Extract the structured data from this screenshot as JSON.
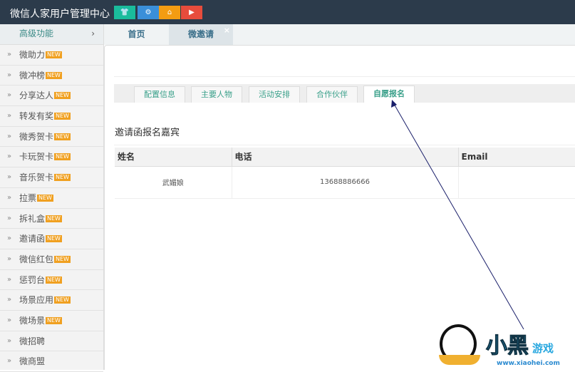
{
  "header": {
    "title": "微信人家用户管理中心",
    "buttons": [
      {
        "icon": "shirt-icon",
        "color": "#1abc9c"
      },
      {
        "icon": "gear-icon",
        "color": "#3a8fd9"
      },
      {
        "icon": "home-icon",
        "color": "#f39c12"
      },
      {
        "icon": "play-icon",
        "color": "#e74c3c"
      }
    ]
  },
  "sidebar": {
    "header": "高级功能",
    "badge": "NEW",
    "items": [
      {
        "label": "微助力",
        "new": true
      },
      {
        "label": "微冲榜",
        "new": true
      },
      {
        "label": "分享达人",
        "new": true
      },
      {
        "label": "转发有奖",
        "new": true
      },
      {
        "label": "微秀贺卡",
        "new": true
      },
      {
        "label": "卡玩贺卡",
        "new": true
      },
      {
        "label": "音乐贺卡",
        "new": true
      },
      {
        "label": "拉票",
        "new": true
      },
      {
        "label": "拆礼盒",
        "new": true
      },
      {
        "label": "邀请函",
        "new": true
      },
      {
        "label": "微信红包",
        "new": true
      },
      {
        "label": "惩罚台",
        "new": true
      },
      {
        "label": "场景应用",
        "new": true
      },
      {
        "label": "微场景",
        "new": true
      },
      {
        "label": "微招聘",
        "new": false
      },
      {
        "label": "微商盟",
        "new": false
      }
    ]
  },
  "tabs": [
    {
      "label": "首页"
    },
    {
      "label": "微邀请",
      "closable": true
    }
  ],
  "subtabs": [
    "配置信息",
    "主要人物",
    "活动安排",
    "合作伙伴",
    "自愿报名"
  ],
  "active_subtab": "自愿报名",
  "section_title": "邀请函报名嘉宾",
  "table": {
    "columns": [
      "姓名",
      "电话",
      "Email"
    ],
    "rows": [
      [
        "武媚娘",
        "13688886666",
        ""
      ]
    ]
  },
  "watermark": {
    "text": "小黑游戏",
    "url": "www.xiaohei.com"
  }
}
